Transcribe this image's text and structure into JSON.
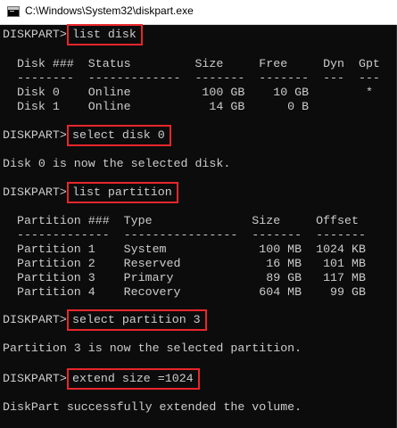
{
  "window": {
    "title": "C:\\Windows\\System32\\diskpart.exe"
  },
  "prompt": "DISKPART>",
  "console": {
    "cmd1": "list disk",
    "disk_header": "  Disk ###  Status         Size     Free     Dyn  Gpt",
    "disk_divider": "  --------  -------------  -------  -------  ---  ---",
    "disk_row_0": "  Disk 0    Online          100 GB    10 GB        *",
    "disk_row_1": "  Disk 1    Online           14 GB      0 B",
    "cmd2": "select disk 0",
    "msg2": "Disk 0 is now the selected disk.",
    "cmd3": "list partition",
    "part_header": "  Partition ###  Type              Size     Offset",
    "part_divider": "  -------------  ----------------  -------  -------",
    "part_row_1": "  Partition 1    System             100 MB  1024 KB",
    "part_row_2": "  Partition 2    Reserved            16 MB   101 MB",
    "part_row_3": "  Partition 3    Primary             89 GB   117 MB",
    "part_row_4": "  Partition 4    Recovery           604 MB    99 GB",
    "cmd4": "select partition 3",
    "msg4": "Partition 3 is now the selected partition.",
    "cmd5": "extend size =1024",
    "msg5": "DiskPart successfully extended the volume."
  },
  "colors": {
    "background": "#0c0c0c",
    "text": "#cccccc",
    "highlight": "#e8262c"
  }
}
